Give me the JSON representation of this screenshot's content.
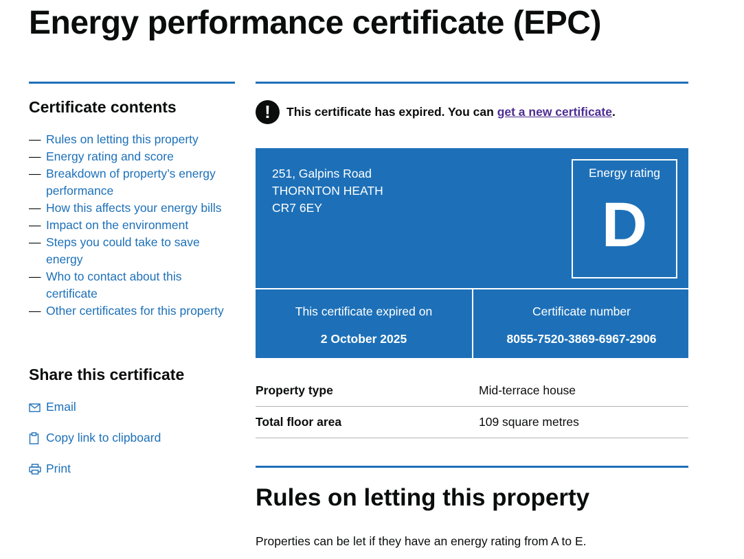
{
  "page": {
    "title": "Energy performance certificate (EPC)"
  },
  "sidebar": {
    "contents_heading": "Certificate contents",
    "contents": [
      "Rules on letting this property",
      "Energy rating and score",
      "Breakdown of property’s energy performance",
      "How this affects your energy bills",
      "Impact on the environment",
      "Steps you could take to save energy",
      "Who to contact about this certificate",
      "Other certificates for this property"
    ],
    "dash": "—",
    "share_heading": "Share this certificate",
    "share": [
      {
        "label": "Email",
        "icon": "envelope-icon"
      },
      {
        "label": "Copy link to clipboard",
        "icon": "clipboard-icon"
      },
      {
        "label": "Print",
        "icon": "printer-icon"
      }
    ]
  },
  "warning": {
    "icon": "!",
    "text": "This certificate has expired. You can ",
    "link": "get a new certificate",
    "end": "."
  },
  "certificate": {
    "address": [
      "251, Galpins Road",
      "THORNTON HEATH",
      "CR7 6EY"
    ],
    "rating_label": "Energy rating",
    "rating": "D",
    "expired_label": "This certificate expired on",
    "expired_date": "2 October 2025",
    "number_label": "Certificate number",
    "number": "8055-7520-3869-6967-2906"
  },
  "summary": [
    {
      "key": "Property type",
      "value": "Mid-terrace house"
    },
    {
      "key": "Total floor area",
      "value": "109 square metres"
    }
  ],
  "section": {
    "title": "Rules on letting this property",
    "body": "Properties can be let if they have an energy rating from A to E."
  },
  "colors": {
    "brand_blue": "#1d70b8",
    "visited_link": "#4c2c92",
    "text": "#0b0c0c"
  }
}
